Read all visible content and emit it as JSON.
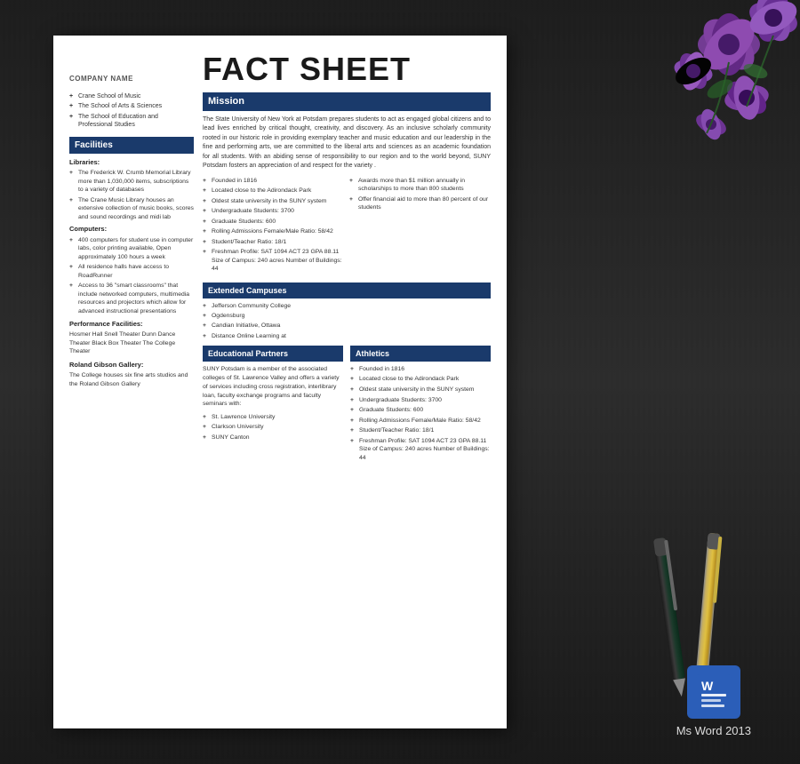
{
  "background": {
    "color": "#2a2a2a"
  },
  "document": {
    "company_name": "COMPANY NAME",
    "title": "FACT SHEET",
    "mission": {
      "header": "Mission",
      "text": "The State University of New York at Potsdam prepares students to act as engaged global citizens and to lead lives enriched by critical thought, creativity, and discovery. As an inclusive scholarly community rooted in our historic role in providing exemplary teacher and music education and our leadership in the fine and performing arts, we are committed to the liberal arts and sciences as an academic foundation for all students. With an abiding sense of responsibility to our region and to the world beyond, SUNY Potsdam fosters an appreciation of and respect for the variety ."
    },
    "left_items": [
      "Crane School of Music",
      "The School of Arts & Sciences",
      "The School of Education and Professional Studies"
    ],
    "facilities": {
      "header": "Facilities",
      "libraries_header": "Libraries:",
      "libraries": [
        "The Frederick W. Crumb Memorial Library more than 1,030,000 items, subscriptions to a variety of databases",
        "The Crane Music Library houses an extensive collection of music books, scores and sound recordings and midi lab"
      ],
      "computers_header": "Computers:",
      "computers": [
        "400 computers for student use in computer labs, color printing available, Open approximately 100 hours a week",
        "All residence halls have access to RoadRunner",
        "Access to 36 \"smart classrooms\" that include networked computers, multimedia resources and projectors which allow for advanced instructional presentations"
      ],
      "performance_header": "Performance Facilities:",
      "performance_text": "Hosmer Hall Snell Theater Dunn Dance Theater Black Box Theater The College Theater",
      "roland_header": "Roland Gibson Gallery:",
      "roland_text": "The College houses six fine arts studios and the Roland Gibson Gallery"
    },
    "stats_col1": [
      "Founded in 1816",
      "Located close to the Adirondack Park",
      "Oldest state university in the SUNY system",
      "Undergraduate Students: 3700",
      "Graduate Students: 600",
      "Rolling Admissions Female/Male Ratio: 58/42",
      "Student/Teacher Ratio: 18/1",
      "Freshman Profile: SAT 1094 ACT 23 GPA 88.11 Size of Campus: 240 acres Number of Buildings: 44"
    ],
    "stats_col2": [
      "Awards more than $1 million annually in scholarships to more than 800 students",
      "Offer financial aid to more than 80 percent of our students"
    ],
    "extended_campuses": {
      "header": "Extended Campuses",
      "items": [
        "Jefferson Community College",
        "Ogdensburg",
        "Candian Initiative, Ottawa",
        "Distance Online Learning at"
      ]
    },
    "educational_partners": {
      "header": "Educational Partners",
      "text": "SUNY Potsdam is a member of the associated colleges of St. Lawrence Valley and offers a variety of services including cross registration, interlibrary loan, faculty exchange programs and faculty seminars with:",
      "items": [
        "St. Lawrence University",
        "Clarkson University",
        "SUNY Canton"
      ]
    },
    "athletics": {
      "header": "Athletics",
      "items": [
        "Founded in 1816",
        "Located close to the Adirondack Park",
        "Oldest state university in the SUNY system",
        "Undergraduate Students: 3700",
        "Graduate Students: 600",
        "Rolling Admissions Female/Male Ratio: 58/42",
        "Student/Teacher Ratio: 18/1",
        "Freshman Profile: SAT 1094 ACT 23 GPA 88.11 Size of Campus: 240 acres Number of Buildings: 44"
      ]
    }
  },
  "badge": {
    "label": "Ms Word 2013"
  }
}
